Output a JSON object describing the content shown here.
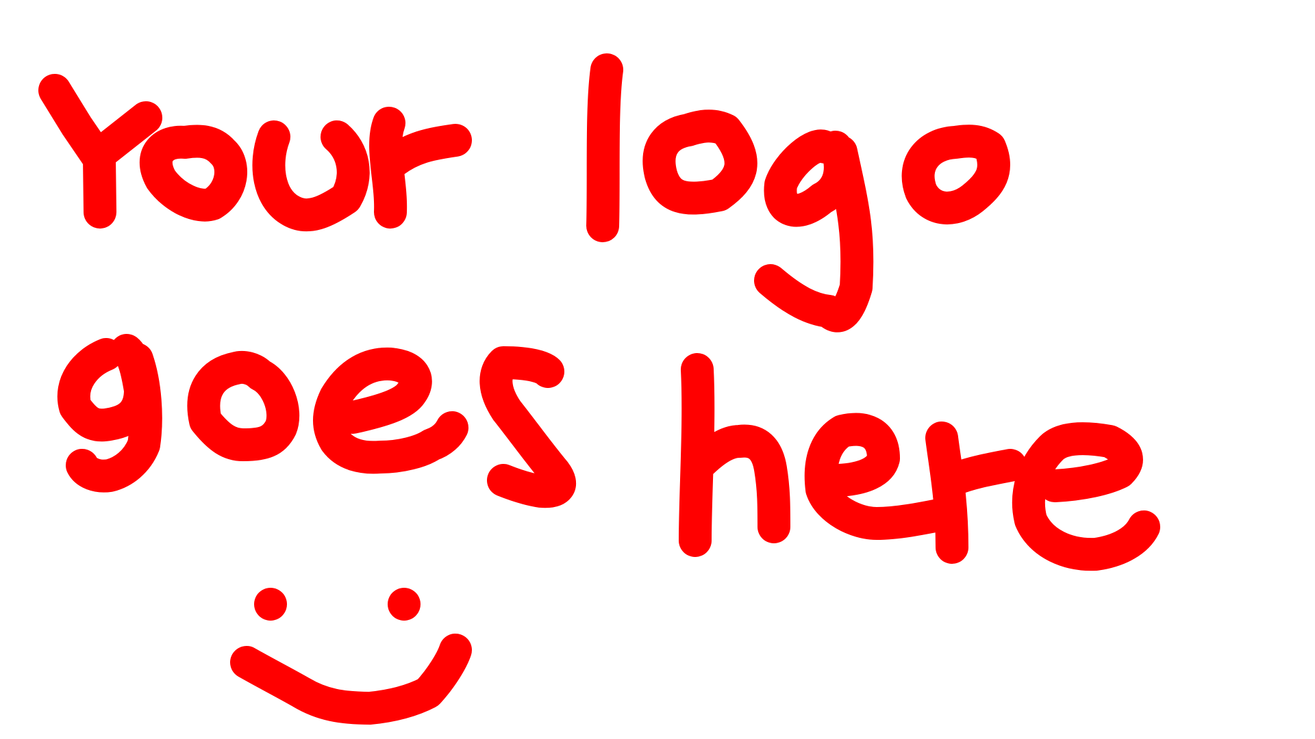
{
  "logo": {
    "text": "Your logo goes here",
    "stroke_color": "#ff0000",
    "background_color": "#ffffff",
    "decoration": "smiley-face"
  }
}
